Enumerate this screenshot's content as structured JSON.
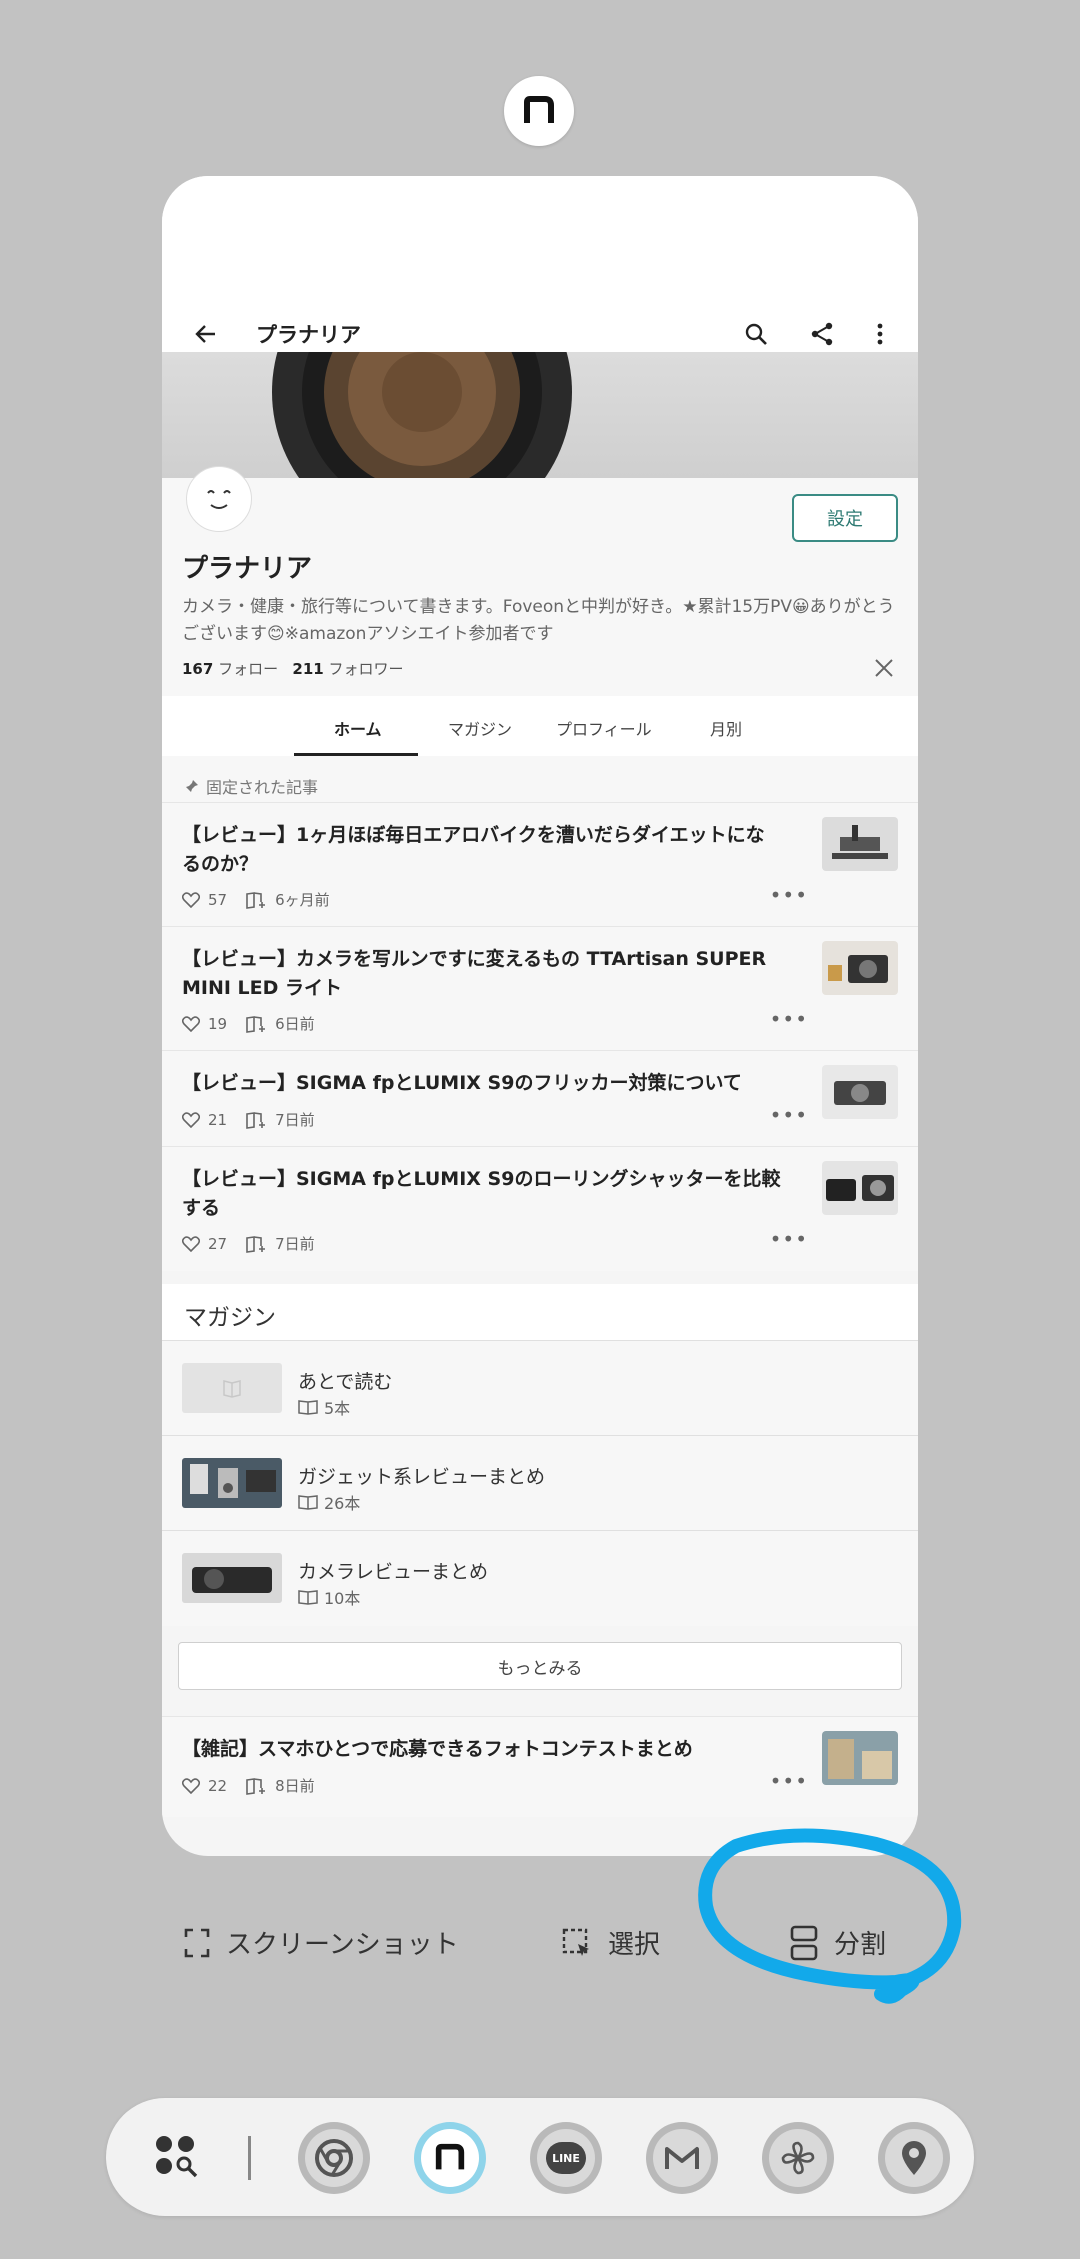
{
  "toolbar": {
    "title": "プラナリア"
  },
  "profile": {
    "name": "プラナリア",
    "settings_label": "設定",
    "bio": "カメラ・健康・旅行等について書きます。Foveonと中判が好き。★累計15万PV😀ありがとうございます😊※amazonアソシエイト参加者です",
    "follow_count": "167",
    "follow_label": "フォロー",
    "follower_count": "211",
    "follower_label": "フォロワー"
  },
  "tabs": [
    "ホーム",
    "マガジン",
    "プロフィール",
    "月別"
  ],
  "pinned_label": "固定された記事",
  "articles": [
    {
      "title": "【レビュー】1ヶ月ほぼ毎日エアロバイクを漕いだらダイエットになるのか？",
      "likes": "57",
      "time": "6ヶ月前"
    },
    {
      "title": "【レビュー】カメラを写ルンですに変えるもの TTArtisan SUPER MINI LED ライト",
      "likes": "19",
      "time": "6日前"
    },
    {
      "title": "【レビュー】SIGMA fpとLUMIX S9のフリッカー対策について",
      "likes": "21",
      "time": "7日前"
    },
    {
      "title": "【レビュー】SIGMA fpとLUMIX S9のローリングシャッターを比較する",
      "likes": "27",
      "time": "7日前"
    }
  ],
  "magazine_heading": "マガジン",
  "magazines": [
    {
      "name": "あとで読む",
      "count": "5本"
    },
    {
      "name": "ガジェット系レビューまとめ",
      "count": "26本"
    },
    {
      "name": "カメラレビューまとめ",
      "count": "10本"
    }
  ],
  "more_label": "もっとみる",
  "last_article": {
    "title": "【雑記】スマホひとつで応募できるフォトコンテストまとめ",
    "likes": "22",
    "time": "8日前"
  },
  "actions": {
    "screenshot": "スクリーンショット",
    "select": "選択",
    "split": "分割"
  },
  "dock": {
    "apps": [
      "chrome-icon",
      "note-icon",
      "line-icon",
      "gmail-icon",
      "pinwheel-icon",
      "maps-icon"
    ],
    "line_text": "LINE"
  },
  "colors": {
    "accent": "#2e7a73",
    "annotation": "#12a9ea"
  }
}
